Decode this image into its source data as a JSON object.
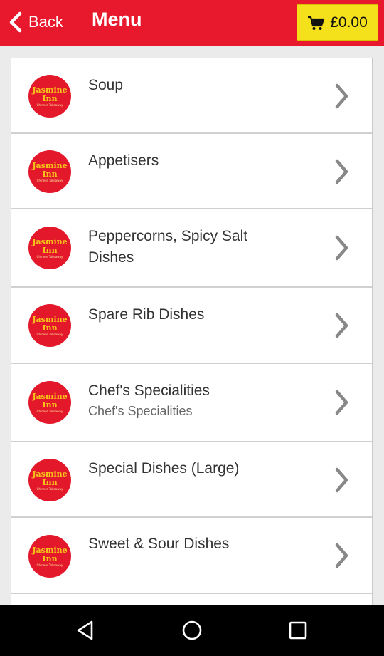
{
  "header": {
    "back_label": "Back",
    "title": "Menu",
    "cart_total": "£0.00",
    "bg_color": "#e8192c",
    "cart_color": "#f5e01c"
  },
  "logo": {
    "line1": "Jasmine",
    "line2": "Inn",
    "line3": "Chinese Takeaway"
  },
  "items": [
    {
      "title": "Soup",
      "subtitle": ""
    },
    {
      "title": "Appetisers",
      "subtitle": ""
    },
    {
      "title": "Peppercorns, Spicy Salt Dishes",
      "subtitle": ""
    },
    {
      "title": "Spare Rib Dishes",
      "subtitle": ""
    },
    {
      "title": "Chef's Specialities",
      "subtitle": "Chef's Specialities"
    },
    {
      "title": "Special Dishes (Large)",
      "subtitle": ""
    },
    {
      "title": "Sweet & Sour Dishes",
      "subtitle": ""
    }
  ],
  "icons": {
    "back": "chevron-left-icon",
    "cart": "shopping-cart-icon",
    "row_arrow": "chevron-right-icon",
    "nav_back": "triangle-back-icon",
    "nav_home": "circle-home-icon",
    "nav_recents": "square-recents-icon"
  }
}
